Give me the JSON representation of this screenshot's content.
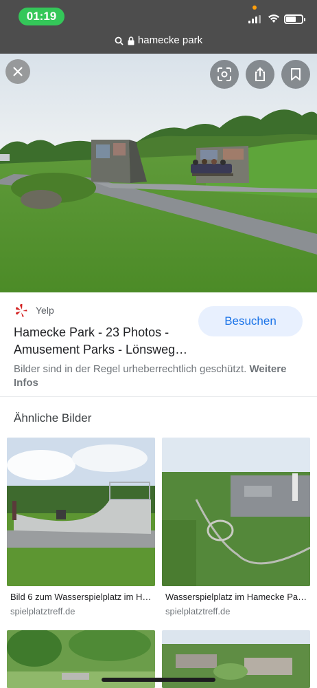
{
  "status_bar": {
    "time": "01:19",
    "url": "hamecke park",
    "icons": [
      "cellular-signal-icon",
      "wifi-icon",
      "battery-icon",
      "lock-icon",
      "search-icon"
    ]
  },
  "viewer": {
    "close_icon": "close-icon",
    "lens_icon": "google-lens-icon",
    "share_icon": "share-icon",
    "save_icon": "bookmark-icon"
  },
  "result": {
    "source": "Yelp",
    "title": "Hamecke Park - 23 Photos - Amusement Parks - Lönsweg…",
    "visit_label": "Besuchen",
    "copyright_text": "Bilder sind in der Regel urheberrechtlich geschützt.",
    "more_info": "Weitere Infos"
  },
  "similar": {
    "heading": "Ähnliche Bilder",
    "items": [
      {
        "caption": "Bild 6 zum Wasserspielplatz im H…",
        "domain": "spielplatztreff.de"
      },
      {
        "caption": "Wasserspielplatz im Hamecke Pa…",
        "domain": "spielplatztreff.de"
      },
      {
        "caption": "",
        "domain": ""
      },
      {
        "caption": "",
        "domain": ""
      }
    ]
  },
  "colors": {
    "accent": "#1a73e8",
    "visit_bg": "#e8f0fe",
    "status_pill": "#34c759",
    "topbar": "#4d4d4d",
    "yelp_red": "#d32323"
  }
}
